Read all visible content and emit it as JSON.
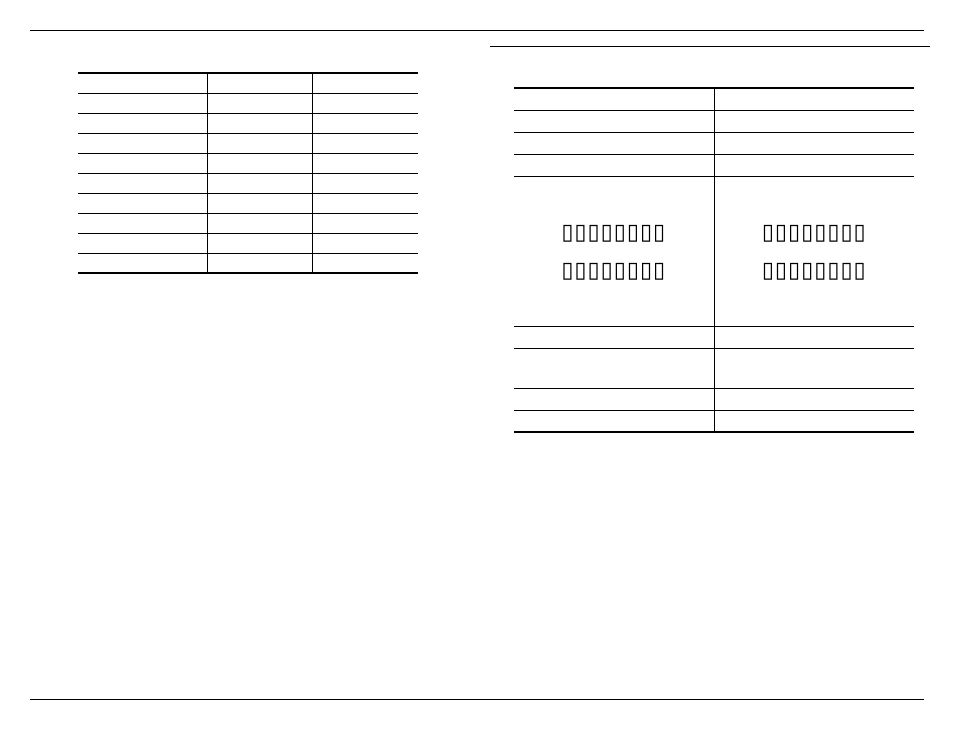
{
  "footer": {
    "left": "",
    "right": ""
  },
  "right_section": {
    "heading": ""
  },
  "table7": {
    "caption": "",
    "head": {
      "metric": "",
      "colA": "",
      "colB": ""
    },
    "rows": [
      {
        "metric": "",
        "a": "",
        "b": ""
      },
      {
        "metric": "",
        "a": "",
        "b": ""
      },
      {
        "metric": "",
        "a": "",
        "b": ""
      },
      {
        "metric": "",
        "a": "",
        "b": ""
      },
      {
        "metric": "",
        "a": "",
        "b": ""
      },
      {
        "metric": "",
        "a": "",
        "b": ""
      },
      {
        "metric": "",
        "a": "",
        "b": ""
      },
      {
        "metric": "",
        "a": "",
        "b": ""
      },
      {
        "metric": "",
        "a": "",
        "b": ""
      }
    ]
  },
  "table8": {
    "caption": "",
    "head": {
      "colA": "",
      "colB": ""
    },
    "r1": {
      "a": "",
      "b": ""
    },
    "r2": {
      "a": "",
      "b": ""
    },
    "r3": {
      "a": "",
      "b": ""
    },
    "glyph": {
      "a1": "▯▯▯▯▯▯▯▯",
      "a2": "▯▯▯▯▯▯▯▯",
      "b1": "▯▯▯▯▯▯▯▯",
      "b2": "▯▯▯▯▯▯▯▯"
    },
    "r5": {
      "a": "",
      "b": ""
    },
    "r6": {
      "a": "",
      "b": ""
    },
    "r7": {
      "a": "",
      "b": ""
    },
    "r8": {
      "a": "",
      "b": ""
    }
  }
}
